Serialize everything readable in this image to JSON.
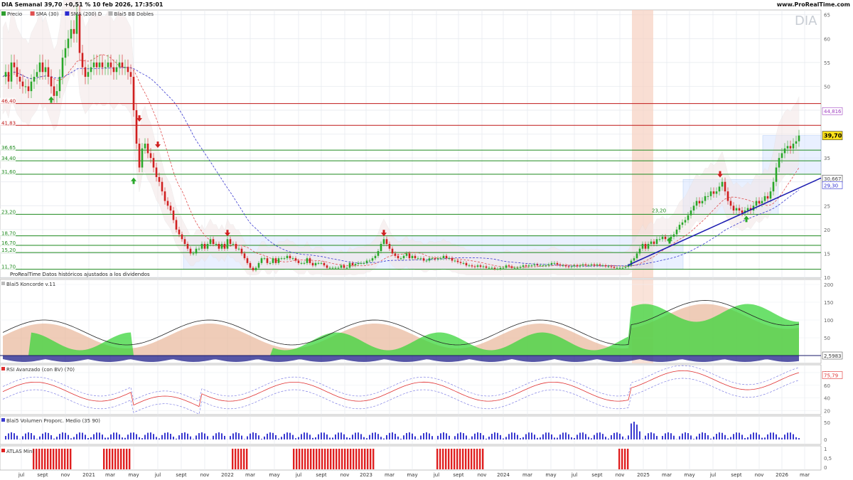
{
  "header": {
    "title": "DIA Semanal 39,70 +0,51 % 10 feb 2026, 17:35:01",
    "site": "www.ProRealTime.com",
    "watermark": "DIA"
  },
  "legend_main": [
    {
      "label": "Precio",
      "color": "#2e9e2e"
    },
    {
      "label": "SMA",
      "param": "(30)",
      "color": "#e05050"
    },
    {
      "label": "SMA",
      "param": "(200)",
      "extra": "D",
      "color": "#2b2bd0"
    },
    {
      "label": "Blai5 BB Dobles",
      "param": "",
      "color": "#b0b0b0"
    }
  ],
  "source_note": {
    "brand": "ProRealTime",
    "text": "Datos históricos ajustados a los dividendos"
  },
  "colors": {
    "up": "#2aa82a",
    "down": "#d02020",
    "sma30": "#e05050",
    "sma200": "#3a3ad0",
    "support": "#1e8a1e",
    "resistance": "#c01818",
    "trend": "#1a1ab0",
    "kon_green": "#3bd63b",
    "kon_blue": "#2c2c90",
    "kon_tan": "#e8b79a",
    "rsi": "#e03030",
    "vol": "#3a3ad0",
    "atlas": "#e02020"
  },
  "panels": {
    "koncorde": {
      "title": "Blai5 Koncorde v.11",
      "value": "2,5983",
      "ticks": [
        "200",
        "150",
        "100",
        "50",
        "0"
      ]
    },
    "rsi": {
      "title": "RSI Avanzado (con BV)",
      "param": "(70)",
      "value": "75,79",
      "ticks": [
        "80",
        "60",
        "40",
        "20"
      ]
    },
    "volume": {
      "title": "Blai5 Volumen Proporc. Medio",
      "param": "(35 90)",
      "ticks": [
        "50",
        "0"
      ]
    },
    "atlas": {
      "title": "ATLAS Mini",
      "ticks": [
        "1",
        "0,5",
        "0"
      ]
    }
  },
  "chart_data": {
    "type": "candlestick",
    "price_axis_ticks": [
      65,
      60,
      55,
      50,
      45,
      40,
      35,
      30,
      25,
      20,
      15,
      10
    ],
    "ylim": [
      10,
      66
    ],
    "x_axis_labels": [
      "jul",
      "sept",
      "nov",
      "2021",
      "mar",
      "may",
      "jul",
      "sept",
      "nov",
      "2022",
      "mar",
      "may",
      "jul",
      "sept",
      "nov",
      "2023",
      "mar",
      "may",
      "jul",
      "sept",
      "nov",
      "2024",
      "mar",
      "may",
      "jul",
      "sept",
      "nov",
      "2025",
      "mar",
      "may",
      "jul",
      "sept",
      "nov",
      "2026",
      "mar"
    ],
    "last_price": "39,70",
    "right_labels": [
      {
        "text": "44,816",
        "value": 44.816,
        "color": "#a040c0"
      },
      {
        "text": "30,667",
        "value": 30.667,
        "color": "#444444"
      },
      {
        "text": "29,30",
        "value": 29.3,
        "color": "#2b2bd0"
      }
    ],
    "horizontal_levels": [
      {
        "text": "46,40",
        "value": 46.4,
        "color": "#c01818"
      },
      {
        "text": "41,83",
        "value": 41.83,
        "color": "#c01818"
      },
      {
        "text": "36,65",
        "value": 36.65,
        "color": "#1e8a1e"
      },
      {
        "text": "34,40",
        "value": 34.4,
        "color": "#1e8a1e"
      },
      {
        "text": "31,60",
        "value": 31.6,
        "color": "#1e8a1e"
      },
      {
        "text": "23,20",
        "value": 23.2,
        "color": "#1e8a1e"
      },
      {
        "text": "18,70",
        "value": 18.7,
        "color": "#1e8a1e"
      },
      {
        "text": "16,70",
        "value": 16.7,
        "color": "#1e8a1e"
      },
      {
        "text": "15,20",
        "value": 15.2,
        "color": "#1e8a1e"
      },
      {
        "text": "11,70",
        "value": 11.7,
        "color": "#1e8a1e"
      }
    ],
    "price_series": [
      [
        0,
        52
      ],
      [
        4,
        53
      ],
      [
        8,
        51
      ],
      [
        12,
        55
      ],
      [
        16,
        54
      ],
      [
        20,
        52
      ],
      [
        24,
        51
      ],
      [
        28,
        50
      ],
      [
        32,
        50
      ],
      [
        36,
        49
      ],
      [
        40,
        51
      ],
      [
        44,
        52
      ],
      [
        48,
        53
      ],
      [
        52,
        55
      ],
      [
        56,
        53
      ],
      [
        60,
        54
      ],
      [
        64,
        52
      ],
      [
        68,
        50
      ],
      [
        72,
        48
      ],
      [
        76,
        49
      ],
      [
        80,
        52
      ],
      [
        84,
        56
      ],
      [
        88,
        58
      ],
      [
        92,
        60
      ],
      [
        96,
        62
      ],
      [
        100,
        61
      ],
      [
        104,
        65
      ],
      [
        108,
        57
      ],
      [
        112,
        54
      ],
      [
        116,
        52
      ],
      [
        120,
        53
      ],
      [
        124,
        54
      ],
      [
        128,
        55
      ],
      [
        132,
        54
      ],
      [
        136,
        55
      ],
      [
        140,
        54
      ],
      [
        144,
        54
      ],
      [
        148,
        55
      ],
      [
        152,
        54
      ],
      [
        156,
        53
      ],
      [
        160,
        54
      ],
      [
        164,
        55
      ],
      [
        168,
        54
      ],
      [
        172,
        54
      ],
      [
        176,
        53
      ],
      [
        180,
        52
      ],
      [
        184,
        45
      ],
      [
        188,
        38
      ],
      [
        192,
        33
      ],
      [
        196,
        37
      ],
      [
        200,
        38
      ],
      [
        204,
        36
      ],
      [
        208,
        35
      ],
      [
        212,
        33
      ],
      [
        216,
        31
      ],
      [
        220,
        30
      ],
      [
        224,
        28
      ],
      [
        228,
        26
      ],
      [
        232,
        25
      ],
      [
        236,
        24
      ],
      [
        240,
        22
      ],
      [
        244,
        20
      ],
      [
        248,
        19
      ],
      [
        252,
        18
      ],
      [
        256,
        17
      ],
      [
        260,
        16
      ],
      [
        264,
        15
      ],
      [
        268,
        15
      ],
      [
        272,
        16
      ],
      [
        276,
        16
      ],
      [
        280,
        17
      ],
      [
        284,
        16
      ],
      [
        288,
        17
      ],
      [
        292,
        18
      ],
      [
        296,
        17
      ],
      [
        300,
        17
      ],
      [
        304,
        16
      ],
      [
        308,
        17
      ],
      [
        312,
        16
      ],
      [
        316,
        18
      ],
      [
        320,
        17
      ],
      [
        324,
        17
      ],
      [
        328,
        16
      ],
      [
        332,
        16
      ],
      [
        336,
        15
      ],
      [
        340,
        14
      ],
      [
        344,
        13
      ],
      [
        348,
        12
      ],
      [
        352,
        11.5
      ],
      [
        356,
        12
      ],
      [
        360,
        13
      ],
      [
        364,
        14
      ],
      [
        368,
        14
      ],
      [
        372,
        13
      ],
      [
        376,
        13
      ],
      [
        380,
        14
      ],
      [
        384,
        13
      ],
      [
        388,
        14
      ],
      [
        392,
        14
      ],
      [
        396,
        14
      ],
      [
        400,
        14.5
      ],
      [
        404,
        14
      ],
      [
        408,
        14
      ],
      [
        412,
        13.5
      ],
      [
        416,
        13
      ],
      [
        420,
        13
      ],
      [
        424,
        13
      ],
      [
        428,
        14
      ],
      [
        432,
        13
      ],
      [
        436,
        12.5
      ],
      [
        440,
        13
      ],
      [
        444,
        13
      ],
      [
        448,
        13
      ],
      [
        452,
        12.5
      ],
      [
        456,
        12
      ],
      [
        460,
        12
      ],
      [
        464,
        12
      ],
      [
        468,
        12
      ],
      [
        472,
        12
      ],
      [
        476,
        12.5
      ],
      [
        480,
        12
      ],
      [
        484,
        12
      ],
      [
        488,
        13
      ],
      [
        492,
        12.5
      ],
      [
        496,
        12.8
      ],
      [
        500,
        13
      ],
      [
        504,
        13
      ],
      [
        508,
        13
      ],
      [
        512,
        13.5
      ],
      [
        516,
        13.5
      ],
      [
        520,
        14
      ],
      [
        524,
        14.5
      ],
      [
        528,
        15.5
      ],
      [
        532,
        17
      ],
      [
        536,
        18
      ],
      [
        540,
        17
      ],
      [
        544,
        16
      ],
      [
        548,
        15
      ],
      [
        552,
        14.5
      ],
      [
        556,
        14
      ],
      [
        560,
        14
      ],
      [
        564,
        14.5
      ],
      [
        568,
        15
      ],
      [
        572,
        14
      ],
      [
        576,
        14.5
      ],
      [
        580,
        14
      ],
      [
        584,
        14
      ],
      [
        588,
        14
      ],
      [
        592,
        13.5
      ],
      [
        596,
        13.5
      ],
      [
        600,
        14
      ],
      [
        604,
        14
      ],
      [
        608,
        13.8
      ],
      [
        612,
        14
      ],
      [
        616,
        14
      ],
      [
        620,
        14.5
      ],
      [
        624,
        14
      ],
      [
        628,
        14
      ],
      [
        632,
        13.5
      ],
      [
        636,
        13.5
      ],
      [
        640,
        13.2
      ],
      [
        644,
        13
      ],
      [
        648,
        13
      ],
      [
        652,
        12.5
      ],
      [
        656,
        12.5
      ],
      [
        660,
        12.3
      ],
      [
        664,
        12.2
      ],
      [
        668,
        12.5
      ],
      [
        672,
        12.2
      ],
      [
        676,
        12.3
      ],
      [
        680,
        12
      ],
      [
        684,
        12
      ],
      [
        688,
        12
      ],
      [
        692,
        11.8
      ],
      [
        696,
        11.8
      ],
      [
        700,
        12
      ],
      [
        704,
        12
      ],
      [
        708,
        12.5
      ],
      [
        712,
        12.3
      ],
      [
        716,
        12
      ],
      [
        720,
        12
      ],
      [
        724,
        12
      ],
      [
        728,
        12.2
      ],
      [
        732,
        12.5
      ],
      [
        736,
        12.3
      ],
      [
        740,
        12.5
      ],
      [
        744,
        12.5
      ],
      [
        748,
        12.7
      ],
      [
        752,
        12.5
      ],
      [
        756,
        12.5
      ],
      [
        760,
        12.5
      ],
      [
        764,
        12.5
      ],
      [
        768,
        12.7
      ],
      [
        772,
        13
      ],
      [
        776,
        13
      ],
      [
        780,
        12.7
      ],
      [
        784,
        12.5
      ],
      [
        788,
        12.5
      ],
      [
        792,
        12.3
      ],
      [
        796,
        12.2
      ],
      [
        800,
        12.3
      ],
      [
        804,
        12.5
      ],
      [
        808,
        12.3
      ],
      [
        812,
        12.5
      ],
      [
        816,
        12.7
      ],
      [
        820,
        12.5
      ],
      [
        824,
        12.5
      ],
      [
        828,
        12.7
      ],
      [
        832,
        12.5
      ],
      [
        836,
        12.7
      ],
      [
        840,
        12.5
      ],
      [
        844,
        12.5
      ],
      [
        848,
        12.3
      ],
      [
        852,
        12.3
      ],
      [
        856,
        12.2
      ],
      [
        860,
        12
      ],
      [
        864,
        12
      ],
      [
        868,
        12
      ],
      [
        872,
        12
      ],
      [
        876,
        12.2
      ],
      [
        880,
        12.5
      ],
      [
        884,
        13.5
      ],
      [
        888,
        14
      ],
      [
        892,
        15
      ],
      [
        896,
        16
      ],
      [
        900,
        17
      ],
      [
        904,
        16
      ],
      [
        908,
        17
      ],
      [
        912,
        17.5
      ],
      [
        916,
        17
      ],
      [
        920,
        18
      ],
      [
        924,
        18
      ],
      [
        928,
        18.5
      ],
      [
        932,
        18
      ],
      [
        936,
        18
      ],
      [
        940,
        18.5
      ],
      [
        944,
        19
      ],
      [
        948,
        20
      ],
      [
        952,
        21
      ],
      [
        956,
        21.5
      ],
      [
        960,
        22
      ],
      [
        964,
        23
      ],
      [
        968,
        24
      ],
      [
        972,
        25
      ],
      [
        976,
        26
      ],
      [
        980,
        25.5
      ],
      [
        984,
        26
      ],
      [
        988,
        27
      ],
      [
        992,
        27
      ],
      [
        996,
        28
      ],
      [
        1000,
        27.5
      ],
      [
        1004,
        28
      ],
      [
        1008,
        29
      ],
      [
        1012,
        30
      ],
      [
        1016,
        28
      ],
      [
        1020,
        26
      ],
      [
        1024,
        25
      ],
      [
        1028,
        24
      ],
      [
        1032,
        24.5
      ],
      [
        1036,
        24
      ],
      [
        1040,
        23.5
      ],
      [
        1044,
        24
      ],
      [
        1048,
        24.5
      ],
      [
        1052,
        24
      ],
      [
        1056,
        25
      ],
      [
        1060,
        26
      ],
      [
        1064,
        25.5
      ],
      [
        1068,
        26
      ],
      [
        1072,
        27
      ],
      [
        1076,
        26.5
      ],
      [
        1080,
        28
      ],
      [
        1084,
        30
      ],
      [
        1088,
        33
      ],
      [
        1092,
        35
      ],
      [
        1096,
        36
      ],
      [
        1100,
        37
      ],
      [
        1104,
        37.5
      ],
      [
        1108,
        37
      ],
      [
        1112,
        38
      ],
      [
        1116,
        38.5
      ],
      [
        1120,
        39.7
      ]
    ]
  }
}
